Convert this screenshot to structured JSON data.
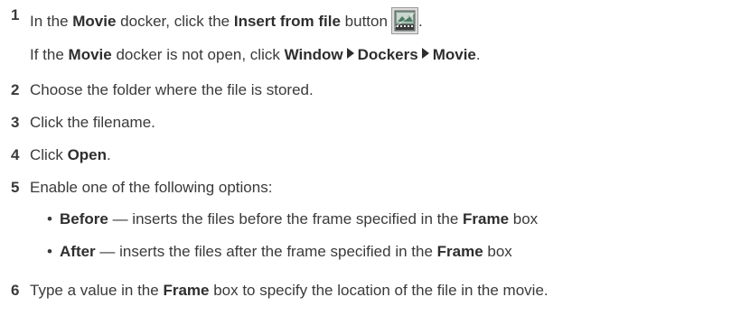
{
  "steps": {
    "s1": {
      "num": "1",
      "pre": "In the ",
      "movie": "Movie",
      "mid": " docker, click the ",
      "insert": "Insert from file",
      "post": " button",
      "end": "."
    },
    "note": {
      "pre": "If the ",
      "movie": "Movie",
      "mid": " docker is not open, click ",
      "window": "Window",
      "dockers": "Dockers",
      "movie2": "Movie",
      "end": "."
    },
    "s2": {
      "num": "2",
      "text": "Choose the folder where the file is stored."
    },
    "s3": {
      "num": "3",
      "text": "Click the filename."
    },
    "s4": {
      "num": "4",
      "pre": "Click ",
      "open": "Open",
      "end": "."
    },
    "s5": {
      "num": "5",
      "text": "Enable one of the following options:"
    },
    "b1": {
      "term": "Before",
      "mid": " — inserts the files before the frame specified in the ",
      "frame": "Frame",
      "end": " box"
    },
    "b2": {
      "term": "After",
      "mid": " — inserts the files after the frame specified in the ",
      "frame": "Frame",
      "end": " box"
    },
    "s6": {
      "num": "6",
      "pre": "Type a value in the ",
      "frame": "Frame",
      "end": " box to specify the location of the file in the movie."
    }
  },
  "icons": {
    "insert_from_file": "insert-from-file-icon"
  }
}
